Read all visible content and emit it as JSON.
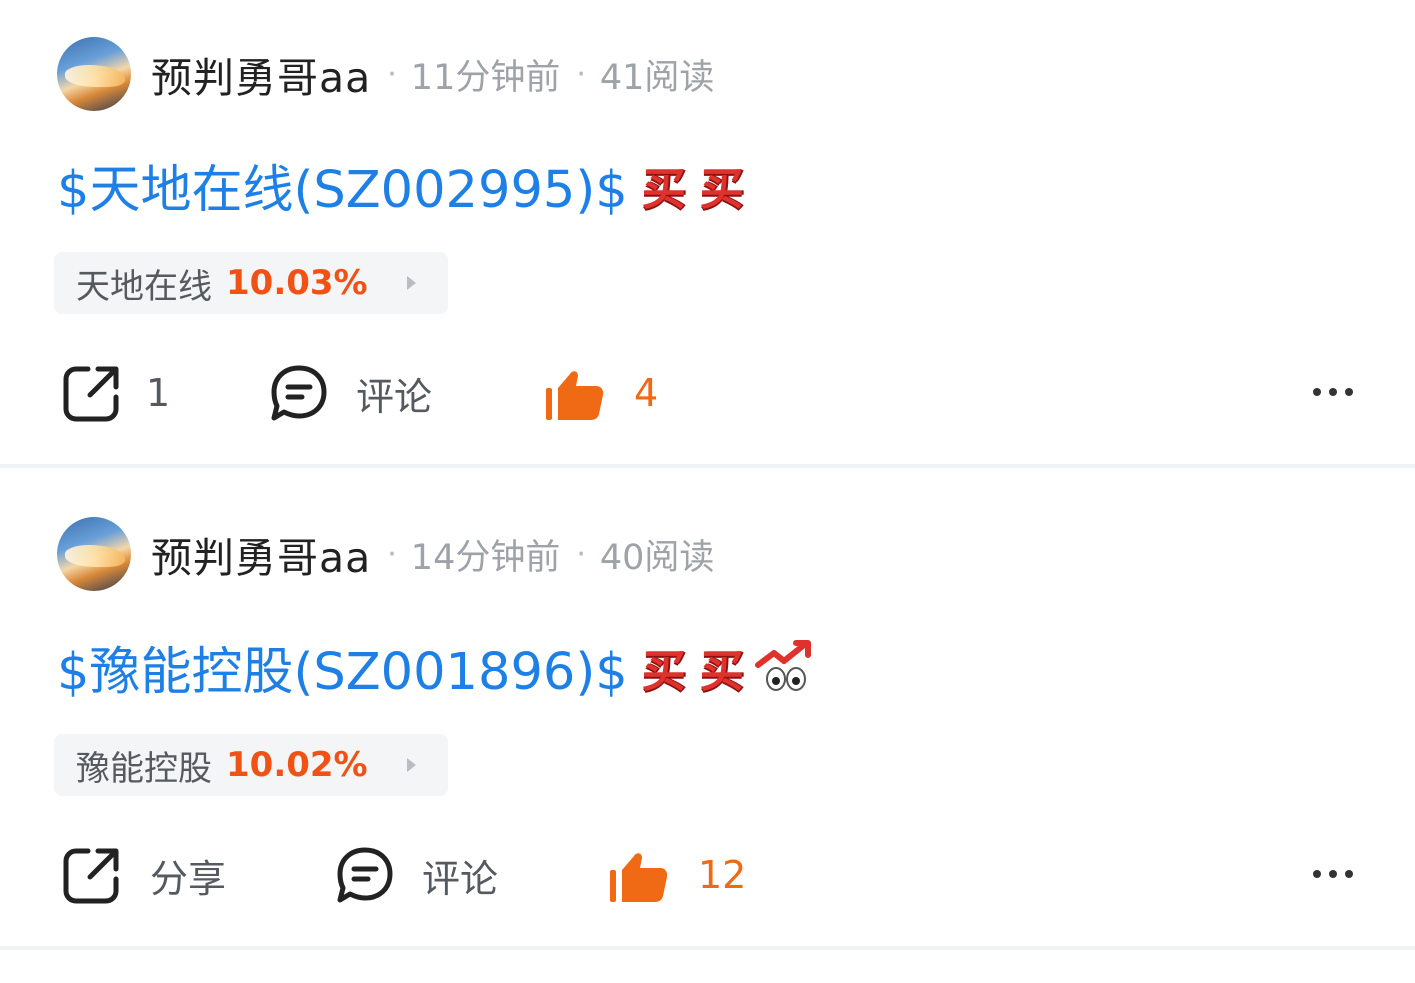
{
  "posts": [
    {
      "username": "预判勇哥aa",
      "time": "11分钟前",
      "reads": "41阅读",
      "dot": "·",
      "title": "$天地在线(SZ002995)$",
      "emoji_buy": "买",
      "stock_name": "天地在线",
      "stock_pct": "10.03%",
      "share_label": "1",
      "comment_label": "评论",
      "like_count": "4",
      "accent_color": "#f05216"
    },
    {
      "username": "预判勇哥aa",
      "time": "14分钟前",
      "reads": "40阅读",
      "dot": "·",
      "title": "$豫能控股(SZ001896)$",
      "emoji_buy": "买",
      "stock_name": "豫能控股",
      "stock_pct": "10.02%",
      "share_label": "分享",
      "comment_label": "评论",
      "like_count": "12",
      "accent_color": "#f05216"
    }
  ],
  "icons": {
    "share": "share-icon",
    "comment": "comment-icon",
    "like": "thumbs-up-icon",
    "more": "more-dots-icon"
  }
}
